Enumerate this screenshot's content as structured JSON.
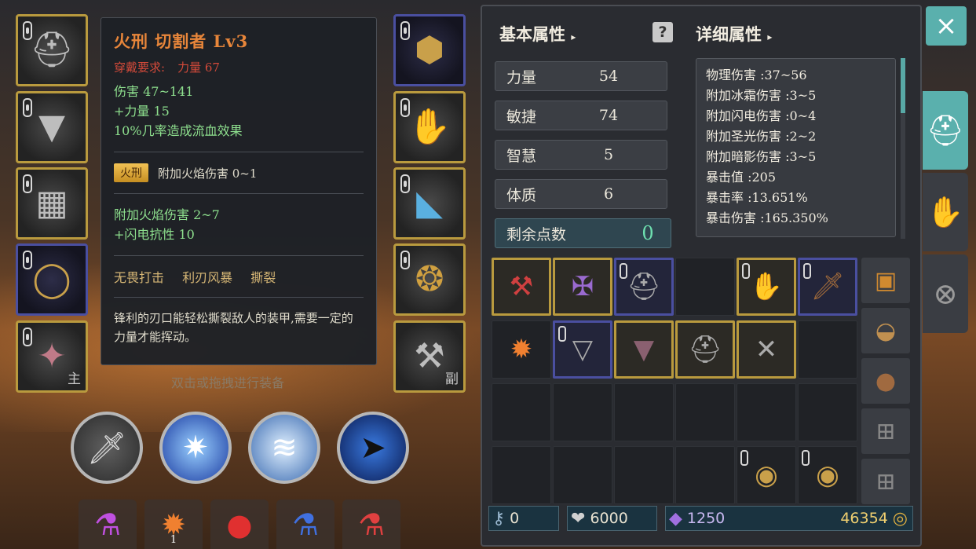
{
  "tooltip": {
    "title": "火刑 切割者 Lv3",
    "req_label": "穿戴要求:",
    "req_value": "力量 67",
    "damage": "伤害 47~141",
    "str_bonus": "+力量 15",
    "bleed": "10%几率造成流血效果",
    "enchant_badge": "火刑",
    "enchant_text": "附加火焰伤害 0~1",
    "extra1": "附加火焰伤害 2~7",
    "extra2": "+闪电抗性 10",
    "skills": [
      "无畏打击",
      "利刃风暴",
      "撕裂"
    ],
    "desc": "锋利的刃口能轻松撕裂敌人的装甲,需要一定的力量才能挥动。"
  },
  "hint": "双击或拖拽进行装备",
  "slot_tags": {
    "main": "主",
    "off": "副"
  },
  "panel": {
    "basic_title": "基本属性",
    "detail_title": "详细属性",
    "help": "?",
    "attributes": [
      {
        "label": "力量",
        "value": "54"
      },
      {
        "label": "敏捷",
        "value": "74"
      },
      {
        "label": "智慧",
        "value": "5"
      },
      {
        "label": "体质",
        "value": "6"
      }
    ],
    "remain_label": "剩余点数",
    "remain_value": "0",
    "details": [
      "物理伤害 :37~56",
      "附加冰霜伤害 :3~5",
      "附加闪电伤害 :0~4",
      "附加圣光伤害 :2~2",
      "附加暗影伤害 :3~5",
      "暴击值 :205",
      "暴击率 :13.651%",
      "暴击伤害 :165.350%"
    ]
  },
  "currency": {
    "keys": "0",
    "hearts": "6000",
    "gems": "1250",
    "gold": "46354"
  },
  "consumables": {
    "fire_count": "1"
  },
  "close": "×",
  "colors": {
    "gold_border": "#b99a3e",
    "blue_border": "#4a4fa0",
    "accent": "#5ab0ad"
  }
}
